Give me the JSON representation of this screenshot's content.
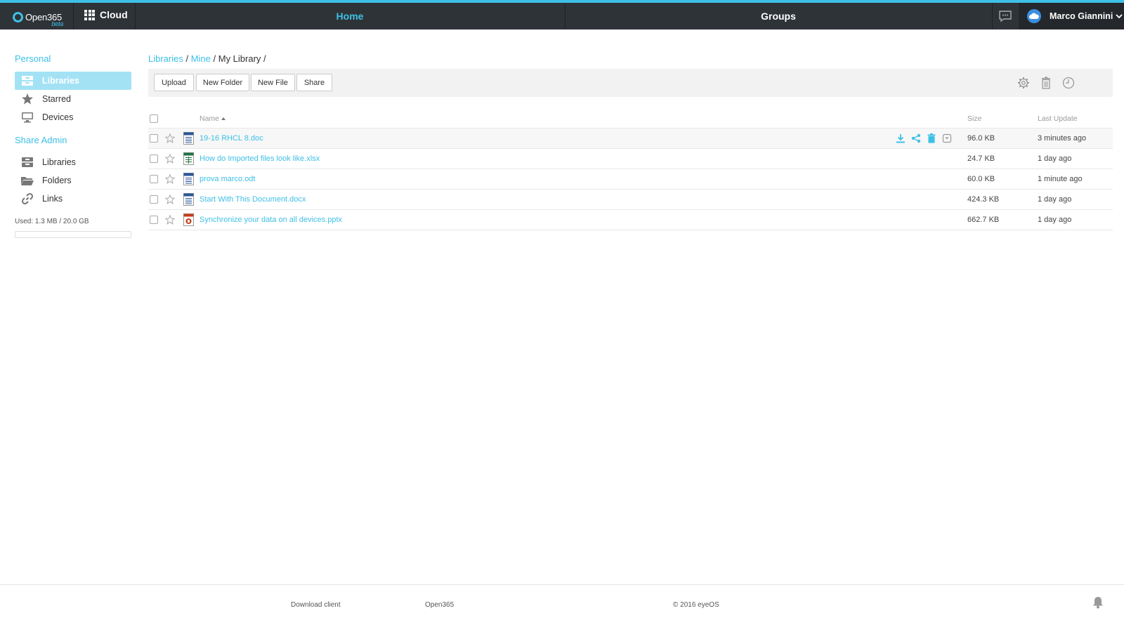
{
  "topbar": {
    "brand": "Open365",
    "brand_badge": "beta",
    "app_label": "Cloud",
    "nav_home": "Home",
    "nav_groups": "Groups",
    "user_name": "Marco Giannini",
    "accent_color": "#3ec0e6",
    "bar_color": "#2e3338"
  },
  "sidebar": {
    "personal_title": "Personal",
    "personal_items": [
      {
        "label": "Libraries",
        "icon": "library-icon",
        "active": true
      },
      {
        "label": "Starred",
        "icon": "star-icon",
        "active": false
      },
      {
        "label": "Devices",
        "icon": "monitor-icon",
        "active": false
      }
    ],
    "share_admin_title": "Share Admin",
    "share_items": [
      {
        "label": "Libraries",
        "icon": "library-icon"
      },
      {
        "label": "Folders",
        "icon": "folder-icon"
      },
      {
        "label": "Links",
        "icon": "link-icon"
      }
    ],
    "usage_text": "Used: 1.3 MB / 20.0 GB",
    "usage_fraction": 0.0001
  },
  "breadcrumb": {
    "part1": "Libraries",
    "sep1": " / ",
    "part2": "Mine",
    "sep2": " / ",
    "part3": "My Library",
    "sep3": " /"
  },
  "toolbar": {
    "upload": "Upload",
    "new_folder": "New Folder",
    "new_file": "New File",
    "share": "Share"
  },
  "table": {
    "col_name": "Name",
    "col_size": "Size",
    "col_update": "Last Update",
    "rows": [
      {
        "name": "19-16 RHCL 8.doc",
        "size": "96.0 KB",
        "updated": "3 minutes ago",
        "type": "doc"
      },
      {
        "name": "How do Imported files look like.xlsx",
        "size": "24.7 KB",
        "updated": "1 day ago",
        "type": "xlsx"
      },
      {
        "name": "prova marco.odt",
        "size": "60.0 KB",
        "updated": "1 minute ago",
        "type": "doc"
      },
      {
        "name": "Start With This Document.docx",
        "size": "424.3 KB",
        "updated": "1 day ago",
        "type": "doc"
      },
      {
        "name": "Synchronize your data on all devices.pptx",
        "size": "662.7 KB",
        "updated": "1 day ago",
        "type": "pptx"
      }
    ]
  },
  "footer": {
    "download_client": "Download client",
    "open365": "Open365",
    "copyright": "© 2016 eyeOS"
  }
}
